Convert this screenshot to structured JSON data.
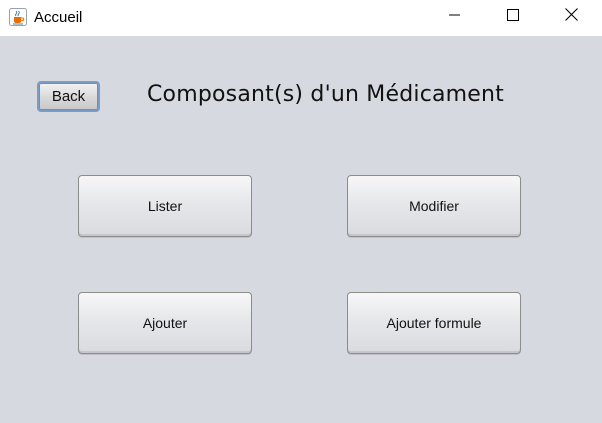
{
  "window": {
    "title": "Accueil",
    "icon": "java-cup-icon"
  },
  "titlebar_controls": {
    "minimize_icon": "minimize-icon",
    "maximize_icon": "maximize-icon",
    "close_icon": "close-icon"
  },
  "main": {
    "back_label": "Back",
    "page_title": "Composant(s) d'un Médicament",
    "buttons": {
      "lister": "Lister",
      "modifier": "Modifier",
      "ajouter": "Ajouter",
      "ajouter_formule": "Ajouter formule"
    }
  },
  "colors": {
    "content_background": "#d6d9e0",
    "back_button_focus_border": "#7a9cc9"
  }
}
